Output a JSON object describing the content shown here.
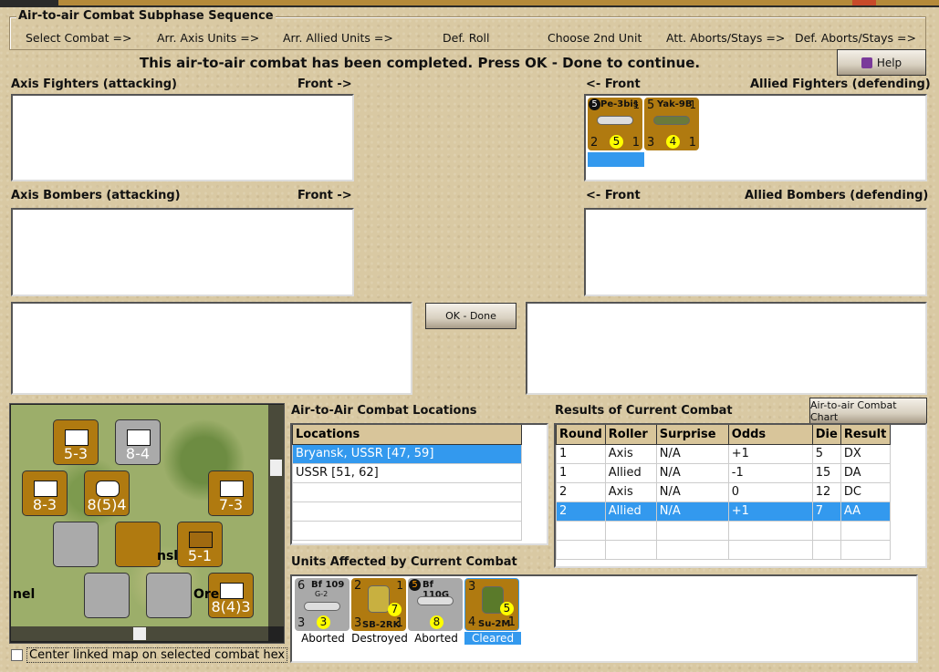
{
  "window": {
    "title": "Air-to-air Combat"
  },
  "sequence": {
    "title": "Air-to-air Combat Subphase Sequence",
    "steps": [
      "Select Combat =>",
      "Arr. Axis Units =>",
      "Arr. Allied Units =>",
      "Def. Roll",
      "Choose 2nd Unit",
      "Att. Aborts/Stays =>",
      "Def. Aborts/Stays =>"
    ]
  },
  "message": "This air-to-air combat has been completed.  Press OK - Done to continue.",
  "help_label": "Help",
  "panels": {
    "axis_fighters": "Axis Fighters (attacking)",
    "axis_fighters_front": "Front ->",
    "allied_fighters": "Allied Fighters (defending)",
    "allied_fighters_front": "<- Front",
    "axis_bombers": "Axis Bombers (attacking)",
    "axis_bombers_front": "Front ->",
    "allied_bombers": "Allied Bombers (defending)",
    "allied_bombers_front": "<- Front"
  },
  "allied_fighters_units": [
    {
      "name": "Pe-3bis",
      "badge": "5",
      "tr": "1",
      "bl": "2",
      "dot": "5",
      "br": "1"
    },
    {
      "name": "Yak-9B",
      "tl": "5",
      "tr": "1",
      "bl": "3",
      "dot": "4",
      "br": "1"
    }
  ],
  "ok_done": "OK - Done",
  "chart_button": "Air-to-air Combat Chart",
  "locations": {
    "title": "Air-to-Air Combat Locations",
    "header": "Locations",
    "rows": [
      "Bryansk, USSR [47, 59]",
      "USSR [51, 62]"
    ]
  },
  "results": {
    "title": "Results of Current Combat",
    "headers": [
      "Round",
      "Roller",
      "Surprise",
      "Odds",
      "Die",
      "Result"
    ],
    "rows": [
      [
        "1",
        "Axis",
        "N/A",
        "+1",
        "5",
        "DX"
      ],
      [
        "1",
        "Allied",
        "N/A",
        "-1",
        "15",
        "DA"
      ],
      [
        "2",
        "Axis",
        "N/A",
        "0",
        "12",
        "DC"
      ],
      [
        "2",
        "Allied",
        "N/A",
        "+1",
        "7",
        "AA"
      ]
    ]
  },
  "affected": {
    "title": "Units Affected by Current Combat",
    "units": [
      {
        "name": "Bf 109",
        "sub": "G-2",
        "tl": "6",
        "bl": "3",
        "dot": "3",
        "status": "Aborted",
        "color": "gray"
      },
      {
        "name": "SB-2RK",
        "tl": "2",
        "tr": "1",
        "bl": "3",
        "br": "1",
        "dot": "7",
        "status": "Destroyed",
        "color": "tan"
      },
      {
        "name": "Bf 110G",
        "badge": "5",
        "dot": "8",
        "status": "Aborted",
        "color": "gray"
      },
      {
        "name": "Su-2M",
        "tl": "3",
        "bl": "4",
        "br": "1",
        "dot": "5",
        "status": "Cleared",
        "color": "tan"
      }
    ]
  },
  "map": {
    "counters": [
      {
        "v": "5-3"
      },
      {
        "v": "8-4"
      },
      {
        "v": "8-3"
      },
      {
        "v": "8(5)4"
      },
      {
        "v": "7-3"
      },
      {
        "v": "5-1"
      },
      {
        "v": "8(4)3"
      }
    ],
    "labels": [
      "nel",
      "Ore",
      "nsl"
    ]
  },
  "center_checkbox": "Center linked map on selected combat hex"
}
